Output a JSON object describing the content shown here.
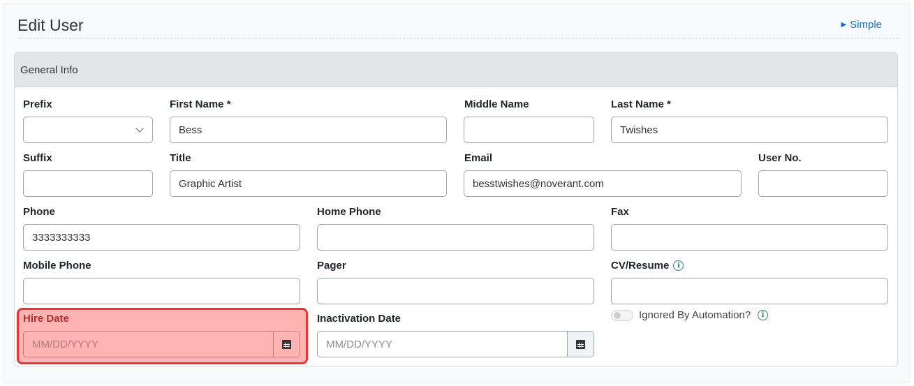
{
  "header": {
    "title": "Edit User",
    "simple_link": "Simple"
  },
  "card": {
    "title": "General Info"
  },
  "fields": {
    "prefix": {
      "label": "Prefix",
      "value": ""
    },
    "first_name": {
      "label": "First Name *",
      "value": "Bess"
    },
    "middle_name": {
      "label": "Middle Name",
      "value": ""
    },
    "last_name": {
      "label": "Last Name *",
      "value": "Twishes"
    },
    "suffix": {
      "label": "Suffix",
      "value": ""
    },
    "title": {
      "label": "Title",
      "value": "Graphic Artist"
    },
    "email": {
      "label": "Email",
      "value": "besstwishes@noverant.com"
    },
    "user_no": {
      "label": "User No.",
      "value": ""
    },
    "phone": {
      "label": "Phone",
      "value": "3333333333"
    },
    "home_phone": {
      "label": "Home Phone",
      "value": ""
    },
    "fax": {
      "label": "Fax",
      "value": ""
    },
    "mobile_phone": {
      "label": "Mobile Phone",
      "value": ""
    },
    "pager": {
      "label": "Pager",
      "value": ""
    },
    "cv_resume": {
      "label": "CV/Resume",
      "value": ""
    },
    "hire_date": {
      "label": "Hire Date",
      "placeholder": "MM/DD/YYYY"
    },
    "inactivation_date": {
      "label": "Inactivation Date",
      "placeholder": "MM/DD/YYYY"
    },
    "ignored_by_automation": {
      "label": "Ignored By Automation?",
      "checked": false
    }
  },
  "colors": {
    "link": "#1b6ec2",
    "highlight": "#ffb3b3",
    "highlight_border": "#e53935",
    "info_icon": "#2e7d6b"
  }
}
